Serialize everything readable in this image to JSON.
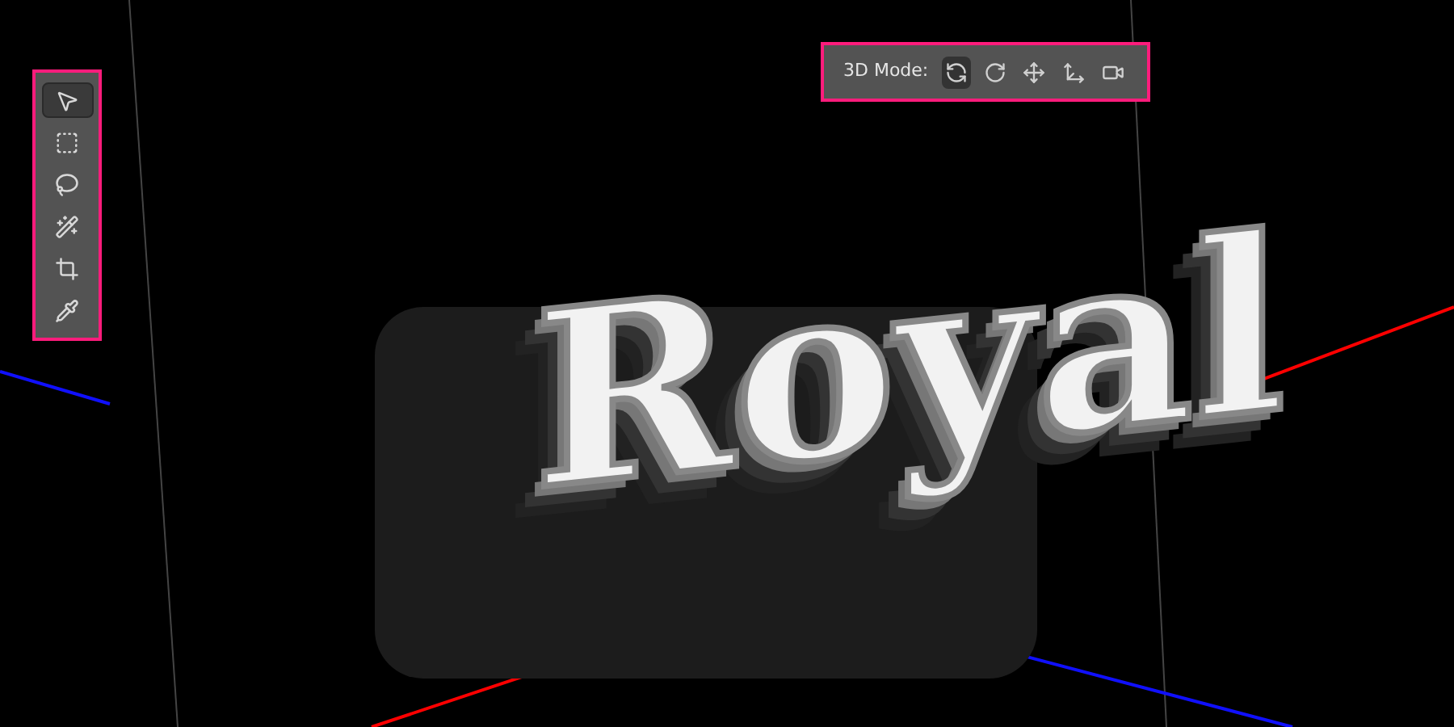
{
  "tools": [
    {
      "kind": "move",
      "selected": true
    },
    {
      "kind": "marquee",
      "selected": false
    },
    {
      "kind": "lasso",
      "selected": false
    },
    {
      "kind": "wand",
      "selected": false
    },
    {
      "kind": "crop",
      "selected": false
    },
    {
      "kind": "eyedropper",
      "selected": false
    }
  ],
  "mode_bar": {
    "label": "3D Mode:",
    "modes": [
      {
        "kind": "orbit",
        "selected": true
      },
      {
        "kind": "roll",
        "selected": false
      },
      {
        "kind": "drag",
        "selected": false
      },
      {
        "kind": "slide",
        "selected": false
      },
      {
        "kind": "zoom",
        "selected": false
      }
    ]
  },
  "canvas": {
    "text": "Royal"
  }
}
